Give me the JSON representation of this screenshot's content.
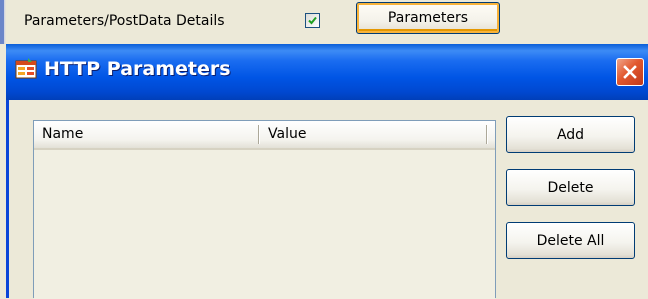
{
  "background_window": {
    "details_label": "Parameters/PostData Details",
    "details_checked": true,
    "parameters_button": "Parameters"
  },
  "dialog": {
    "title": "HTTP Parameters",
    "title_icon": "table-app-icon",
    "close_icon": "close-icon",
    "list": {
      "columns": [
        "Name",
        "Value"
      ],
      "rows": []
    },
    "buttons": {
      "add": "Add",
      "delete": "Delete",
      "delete_all": "Delete All"
    }
  },
  "colors": {
    "titlebar": "#0055e5",
    "close_button": "#e2582e",
    "dialog_bg": "#ece9d8",
    "focus_ring": "#f8b33a"
  }
}
